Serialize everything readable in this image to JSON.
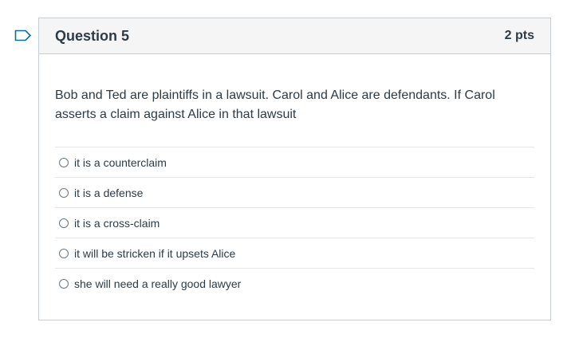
{
  "question": {
    "title": "Question 5",
    "points": "2 pts",
    "text": "Bob and Ted are plaintiffs in a lawsuit. Carol and Alice are defendants. If Carol asserts a claim against Alice in that lawsuit",
    "flag_icon": "bookmark-flag-icon",
    "accent_color": "#0770a3"
  },
  "answers": [
    {
      "label": "it is a counterclaim"
    },
    {
      "label": "it is a defense"
    },
    {
      "label": "it is a cross-claim"
    },
    {
      "label": "it will be stricken if it upsets Alice"
    },
    {
      "label": "she will need a really good lawyer"
    }
  ]
}
